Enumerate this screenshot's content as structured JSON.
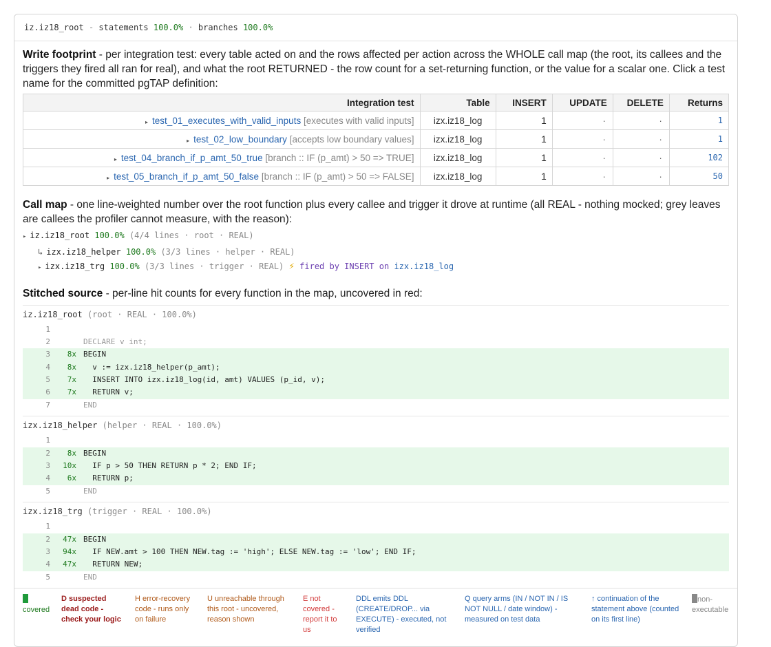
{
  "header": {
    "root_name": "iz.iz18_root",
    "statements_label": "statements",
    "statements_pct": "100.0%",
    "branches_label": "branches",
    "branches_pct": "100.0%"
  },
  "footprint": {
    "title": "Write footprint",
    "description": " - per integration test: every table acted on and the rows affected per action across the WHOLE call map (the root, its callees and the triggers they fired all ran for real), and what the root RETURNED - the row count for a set-returning function, or the value for a scalar one. Click a test name for the committed pgTAP definition:",
    "columns": [
      "Integration test",
      "Table",
      "INSERT",
      "UPDATE",
      "DELETE",
      "Returns"
    ],
    "rows": [
      {
        "test": "test_01_executes_with_valid_inputs",
        "desc": "[executes with valid inputs]",
        "table": "izx.iz18_log",
        "insert": "1",
        "update": "·",
        "delete": "·",
        "returns": "1"
      },
      {
        "test": "test_02_low_boundary",
        "desc": "[accepts low boundary values]",
        "table": "izx.iz18_log",
        "insert": "1",
        "update": "·",
        "delete": "·",
        "returns": "1"
      },
      {
        "test": "test_04_branch_if_p_amt_50_true",
        "desc": "[branch :: IF (p_amt) > 50 => TRUE]",
        "table": "izx.iz18_log",
        "insert": "1",
        "update": "·",
        "delete": "·",
        "returns": "102"
      },
      {
        "test": "test_05_branch_if_p_amt_50_false",
        "desc": "[branch :: IF (p_amt) > 50 => FALSE]",
        "table": "izx.iz18_log",
        "insert": "1",
        "update": "·",
        "delete": "·",
        "returns": "50"
      }
    ]
  },
  "callmap": {
    "title": "Call map",
    "description": " - one line-weighted number over the root function plus every callee and trigger it drove at runtime (all REAL - nothing mocked; grey leaves are callees the profiler cannot measure, with the reason):",
    "items": [
      {
        "marker": "▸",
        "name": "iz.iz18_root",
        "pct": "100.0%",
        "meta": "(4/4 lines · root · REAL)",
        "extra": ""
      },
      {
        "marker": "↳",
        "name": "izx.iz18_helper",
        "pct": "100.0%",
        "meta": "(3/3 lines · helper · REAL)",
        "extra": ""
      },
      {
        "marker": "▸",
        "name": "izx.iz18_trg",
        "pct": "100.0%",
        "meta": "(3/3 lines · trigger · REAL)",
        "extra": "fired by INSERT on",
        "extra_link": "izx.iz18_log"
      }
    ]
  },
  "stitched": {
    "title": "Stitched source",
    "description": " - per-line hit counts for every function in the map, uncovered in red:",
    "functions": [
      {
        "name": "iz.iz18_root",
        "meta": "(root · REAL · 100.0%)",
        "lines": [
          {
            "n": "1",
            "hits": "",
            "code": "",
            "hit": false
          },
          {
            "n": "2",
            "hits": "",
            "code": "DECLARE v int;",
            "hit": false
          },
          {
            "n": "3",
            "hits": "8x",
            "code": "BEGIN",
            "hit": true
          },
          {
            "n": "4",
            "hits": "8x",
            "code": "  v := izx.iz18_helper(p_amt);",
            "hit": true
          },
          {
            "n": "5",
            "hits": "7x",
            "code": "  INSERT INTO izx.iz18_log(id, amt) VALUES (p_id, v);",
            "hit": true
          },
          {
            "n": "6",
            "hits": "7x",
            "code": "  RETURN v;",
            "hit": true
          },
          {
            "n": "7",
            "hits": "",
            "code": "END",
            "hit": false
          }
        ]
      },
      {
        "name": "izx.iz18_helper",
        "meta": "(helper · REAL · 100.0%)",
        "lines": [
          {
            "n": "1",
            "hits": "",
            "code": "",
            "hit": false
          },
          {
            "n": "2",
            "hits": "8x",
            "code": "BEGIN",
            "hit": true
          },
          {
            "n": "3",
            "hits": "10x",
            "code": "  IF p > 50 THEN RETURN p * 2; END IF;",
            "hit": true
          },
          {
            "n": "4",
            "hits": "6x",
            "code": "  RETURN p;",
            "hit": true
          },
          {
            "n": "5",
            "hits": "",
            "code": "END",
            "hit": false
          }
        ]
      },
      {
        "name": "izx.iz18_trg",
        "meta": "(trigger · REAL · 100.0%)",
        "lines": [
          {
            "n": "1",
            "hits": "",
            "code": "",
            "hit": false
          },
          {
            "n": "2",
            "hits": "47x",
            "code": "BEGIN",
            "hit": true
          },
          {
            "n": "3",
            "hits": "94x",
            "code": "  IF NEW.amt > 100 THEN NEW.tag := 'high'; ELSE NEW.tag := 'low'; END IF;",
            "hit": true
          },
          {
            "n": "4",
            "hits": "47x",
            "code": "  RETURN NEW;",
            "hit": true
          },
          {
            "n": "5",
            "hits": "",
            "code": "END",
            "hit": false
          }
        ]
      }
    ]
  },
  "legend": {
    "covered": "covered",
    "dead": "D suspected dead code - check your logic",
    "error": "H error-recovery code - runs only on failure",
    "unreachable": "U unreachable through this root - uncovered, reason shown",
    "notcovered": "E not covered - report it to us",
    "ddl": "DDL emits DDL (CREATE/DROP... via EXECUTE) - executed, not verified",
    "query": "Q query arms (IN / NOT IN / IS NOT NULL / date window) - measured on test data",
    "continuation": "↑ continuation of the statement above (counted on its first line)",
    "nonexec": "non-executable",
    "colors": {
      "covered": "#1f9a3a",
      "dead": "#9b1c1c",
      "error": "#b05a1a",
      "notcovered": "#d23a3a",
      "ddl": "#2a66b0",
      "nonexec": "#888888",
      "hitbg": "#e6f8e9"
    }
  }
}
